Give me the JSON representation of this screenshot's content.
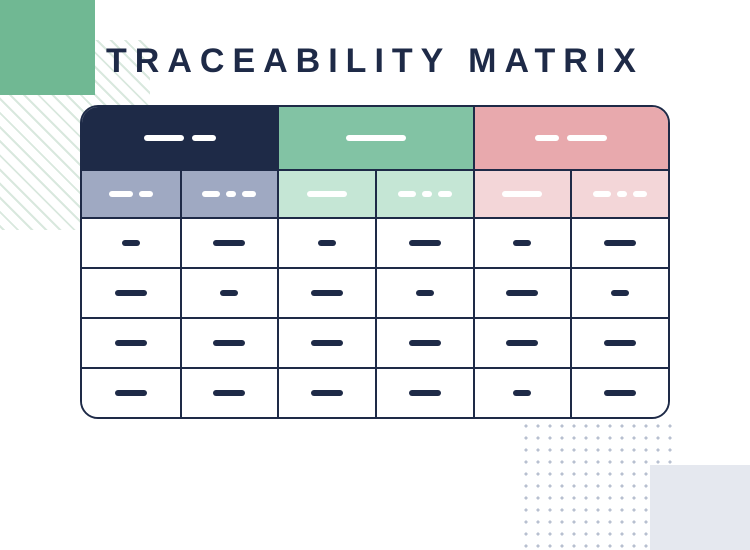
{
  "title": "TRACEABILITY MATRIX",
  "colors": {
    "navy": "#1e2a47",
    "green": "#82c3a4",
    "pink": "#e8a9ad",
    "subNavy": "#9fa9c2",
    "subGreen": "#c5e6d5",
    "subPink": "#f3d6d8"
  },
  "groupHeaders": [
    {
      "segments": [
        "long",
        "short"
      ],
      "colorKey": "navy"
    },
    {
      "segments": [
        "longer"
      ],
      "colorKey": "green"
    },
    {
      "segments": [
        "short",
        "medium"
      ],
      "colorKey": "pink"
    }
  ],
  "subHeaders": [
    {
      "segments": [
        "short",
        "tiny"
      ],
      "group": 0
    },
    {
      "segments": [
        "short",
        "tiny",
        "tiny"
      ],
      "group": 0
    },
    {
      "segments": [
        "long"
      ],
      "group": 1
    },
    {
      "segments": [
        "short",
        "tiny",
        "tiny"
      ],
      "group": 1
    },
    {
      "segments": [
        "long"
      ],
      "group": 2
    },
    {
      "segments": [
        "short",
        "tiny",
        "tiny"
      ],
      "group": 2
    }
  ],
  "rows": [
    [
      {
        "w": "s"
      },
      {
        "w": "m"
      },
      {
        "w": "s"
      },
      {
        "w": "m"
      },
      {
        "w": "s"
      },
      {
        "w": "m"
      }
    ],
    [
      {
        "w": "m"
      },
      {
        "w": "s"
      },
      {
        "w": "m"
      },
      {
        "w": "s"
      },
      {
        "w": "m"
      },
      {
        "w": "s"
      }
    ],
    [
      {
        "w": "m"
      },
      {
        "w": "m"
      },
      {
        "w": "m"
      },
      {
        "w": "m"
      },
      {
        "w": "m"
      },
      {
        "w": "m"
      }
    ],
    [
      {
        "w": "m"
      },
      {
        "w": "m"
      },
      {
        "w": "m"
      },
      {
        "w": "m"
      },
      {
        "w": "s"
      },
      {
        "w": "m"
      }
    ]
  ]
}
